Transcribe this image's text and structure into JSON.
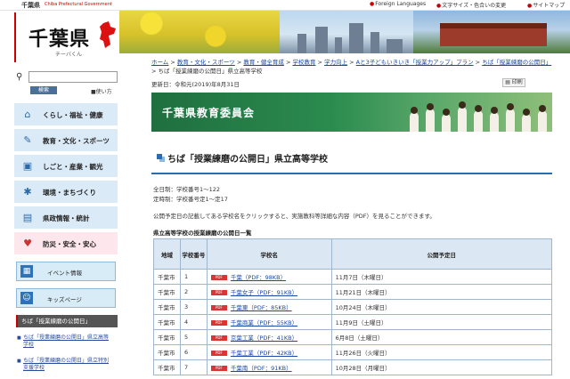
{
  "topbar": {
    "brand": "千葉県",
    "brand_en": "Chiba Prefectural Government",
    "foreign": "Foreign Languages",
    "textsize": "文字サイズ・色合いの変更",
    "sitemap": "サイトマップ"
  },
  "logo": {
    "name": "千葉県",
    "sub": "チーバくん"
  },
  "search": {
    "button": "検索",
    "howto": "使い方"
  },
  "nav": [
    {
      "label": "くらし・福祉・健康",
      "icon": "house-icon"
    },
    {
      "label": "教育・文化・スポーツ",
      "icon": "pen-icon"
    },
    {
      "label": "しごと・産業・観光",
      "icon": "briefcase-icon"
    },
    {
      "label": "環境・まちづくり",
      "icon": "town-icon"
    },
    {
      "label": "県政情報・統計",
      "icon": "book-icon"
    },
    {
      "label": "防災・安全・安心",
      "icon": "heart-icon"
    }
  ],
  "pills": [
    {
      "label": "イベント情報"
    },
    {
      "label": "キッズページ"
    }
  ],
  "sidebar_current": "ちば「授業練磨の公開日」",
  "sidebar_links": [
    "ちば「授業練磨の公開日」県立高等学校",
    "ちば「授業練磨の公開日」県立特別支援学校"
  ],
  "breadcrumbs": {
    "items": [
      "ホーム",
      "教育・文化・スポーツ",
      "教育・健全育成",
      "学校教育",
      "学力向上",
      "Aと3子どもいきいき「授業力アップ」プラン",
      "ちば「授業練磨の公開日」"
    ],
    "current": "ちば「授業練磨の公開日」県立高等学校"
  },
  "updated": "更新日：令和元(2019)年8月31日",
  "print_label": "印刷",
  "hero_title": "千葉県教育委員会",
  "page_title": "ちば「授業練磨の公開日」県立高等学校",
  "info": {
    "line1": "全日制：学校番号1～122",
    "line2": "定時制：学校番号定1～定17",
    "line3": "公開予定日の記載してある学校名をクリックすると、実施教科等詳細な内容（PDF）を見ることができます。"
  },
  "table": {
    "caption": "県立高等学校の授業練磨の公開日一覧",
    "headers": {
      "area": "地域",
      "num": "学校番号",
      "school": "学校名",
      "date": "公開予定日"
    },
    "pdf_badge": "PDF",
    "rows": [
      {
        "area": "千葉市",
        "num": "1",
        "school": "千葉（PDF：98KB）",
        "date": "11月7日（木曜日）"
      },
      {
        "area": "千葉市",
        "num": "2",
        "school": "千葉女子（PDF：91KB）",
        "date": "11月21日（木曜日）"
      },
      {
        "area": "千葉市",
        "num": "3",
        "school": "千葉東（PDF：85KB）",
        "date": "10月24日（木曜日）"
      },
      {
        "area": "千葉市",
        "num": "4",
        "school": "千葉商業（PDF：55KB）",
        "date": "11月9日（土曜日）"
      },
      {
        "area": "千葉市",
        "num": "5",
        "school": "京葉工業（PDF：41KB）",
        "date": "6月8日（土曜日）"
      },
      {
        "area": "千葉市",
        "num": "6",
        "school": "千葉工業（PDF：42KB）",
        "date": "11月26日（火曜日）"
      },
      {
        "area": "千葉市",
        "num": "7",
        "school": "千葉南（PDF：91KB）",
        "date": "10月28日（月曜日）"
      }
    ]
  }
}
